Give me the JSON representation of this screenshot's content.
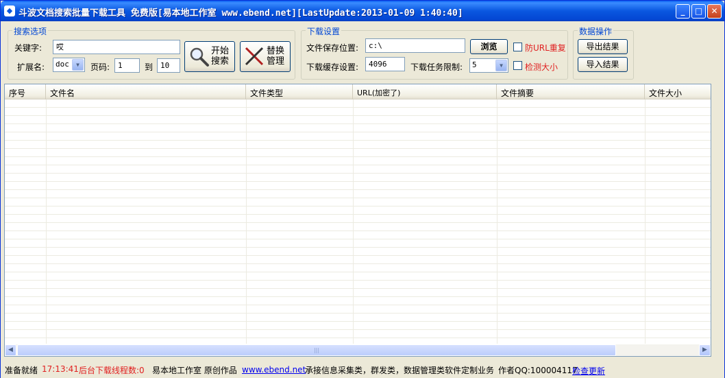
{
  "window": {
    "title": "斗波文档搜索批量下载工具 免费版[易本地工作室 www.ebend.net][LastUpdate:2013-01-09 1:40:40]",
    "minimize": "_",
    "maximize": "□",
    "close": "✕"
  },
  "search": {
    "legend": "搜索选项",
    "keyword_label": "关键字:",
    "keyword_value": "哎",
    "ext_label": "扩展名:",
    "ext_value": "doc",
    "page_label": "页码:",
    "page_from": "1",
    "to_label": "到",
    "page_to": "10",
    "start_button_l1": "开始",
    "start_button_l2": "搜索",
    "replace_button_l1": "替换",
    "replace_button_l2": "管理"
  },
  "download": {
    "legend": "下载设置",
    "save_label": "文件保存位置:",
    "save_value": "c:\\",
    "browse_button": "浏览",
    "dedupe_label": "防URL重复",
    "cache_label": "下载缓存设置:",
    "cache_value": "4096",
    "limit_label": "下载任务限制:",
    "limit_value": "5",
    "check_size_label": "检测大小"
  },
  "data_ops": {
    "legend": "数据操作",
    "export_button": "导出结果",
    "import_button": "导入结果"
  },
  "table": {
    "columns": [
      "序号",
      "文件名",
      "文件类型",
      "URL(加密了)",
      "文件摘要",
      "文件大小"
    ],
    "rows": []
  },
  "status": {
    "ready": "准备就绪",
    "time": "17:13:41",
    "threads": "后台下载线程数:0",
    "credit": "易本地工作室  原创作品",
    "site_link": "www.ebend.net",
    "services": "承接信息采集类，群发类，数据管理类软件定制业务",
    "author_qq": "作者QQ:100004117",
    "update_link": "检查更新"
  },
  "colors": {
    "title_bar": "#0a57e0",
    "legend": "#0046d5",
    "warning_text": "#e02020",
    "link": "#0000ee"
  }
}
